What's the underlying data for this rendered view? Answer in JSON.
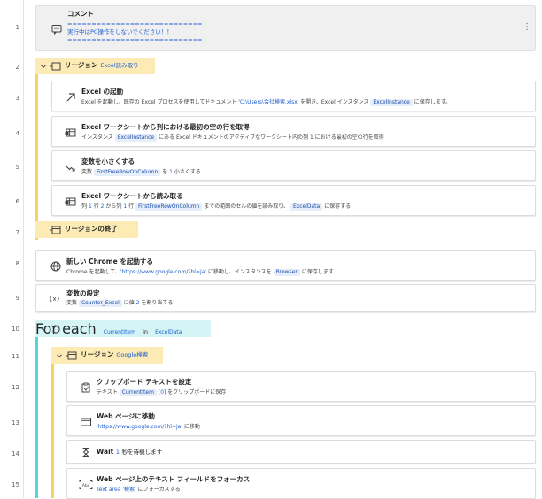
{
  "line_numbers": [
    "1",
    "2",
    "3",
    "4",
    "5",
    "6",
    "7",
    "8",
    "9",
    "10",
    "11",
    "12",
    "13",
    "14",
    "15"
  ],
  "colors": {
    "region_bg": "#fdebb6",
    "region_bar": "#f7d45a",
    "loop_bg": "#d4f4f6",
    "loop_bar": "#4fd6de",
    "link_blue": "#1f5ed1",
    "chip_bg": "#e6eefa"
  },
  "comment": {
    "title": "コメント",
    "line1": "============================",
    "line2": "実行中はPC操作をしないでください！！！",
    "line3": "============================",
    "more_icon": "⋮"
  },
  "region1": {
    "keyword": "リージョン",
    "name": "Excel読み取り"
  },
  "step3": {
    "title": "Excel の起動",
    "d1": "Excel を起動し、既存の Excel プロセスを使用してドキュメント '",
    "path": "C:\\Users\\会社検索.xlsx",
    "d2": "' を開き、Excel インスタンス",
    "chip": "ExcelInstance",
    "d3": "に保存します。"
  },
  "step4": {
    "title": "Excel ワークシートから列における最初の空の行を取得",
    "d1": "インスタンス",
    "chip": "ExcelInstance",
    "d2": "にある Excel ドキュメントのアクティブなワークシート内の列 1 における最初の空の行を取得"
  },
  "step5": {
    "title": "変数を小さくする",
    "d1": "変数",
    "chip": "FirstFreeRowOnColumn",
    "d2": "を",
    "num": "1",
    "d3": "小さくする"
  },
  "step6": {
    "title": "Excel ワークシートから読み取る",
    "d1": "列",
    "n1": "1",
    "d2": "行",
    "n2": "2",
    "d3": "から列",
    "n3": "1",
    "d4": "行",
    "chip1": "FirstFreeRowOnColumn",
    "d5": "までの範囲のセルの値を読み取り、",
    "chip2": "ExcelData",
    "d6": "に保存する"
  },
  "region_end": {
    "label": "リージョンの終了"
  },
  "step8": {
    "title": "新しい Chrome を起動する",
    "d1": "Chrome を起動して、",
    "url": "'https://www.google.com/?hl=ja'",
    "d2": "に移動し、インスタンスを",
    "chip": "Browser",
    "d3": "に保存します"
  },
  "step9": {
    "title": "変数の設定",
    "d1": "変数",
    "chip": "Counter_Excel",
    "d2": "に値",
    "num": "2",
    "d3": "を割り当てる",
    "icon_text": "{x}"
  },
  "loop": {
    "keyword": "For each",
    "var": "CurrentItem",
    "in": "in",
    "list": "ExcelData"
  },
  "region2": {
    "keyword": "リージョン",
    "name": "Google検索"
  },
  "step12": {
    "title": "クリップボード テキストを設定",
    "d1": "テキスト",
    "chip": "CurrentItem",
    "idx": "[0]",
    "d2": "をクリップボードに保存"
  },
  "step13": {
    "title": "Web ページに移動",
    "url": "'https://www.google.com/?hl=ja'",
    "d1": "に移動"
  },
  "step14": {
    "title": "Wait",
    "num": "1",
    "d1": "秒を待機します"
  },
  "step15": {
    "title": "Web ページ上のテキスト フィールドをフォーカス",
    "d1": "Text area '検索'",
    "d2": "にフォーカスする"
  }
}
